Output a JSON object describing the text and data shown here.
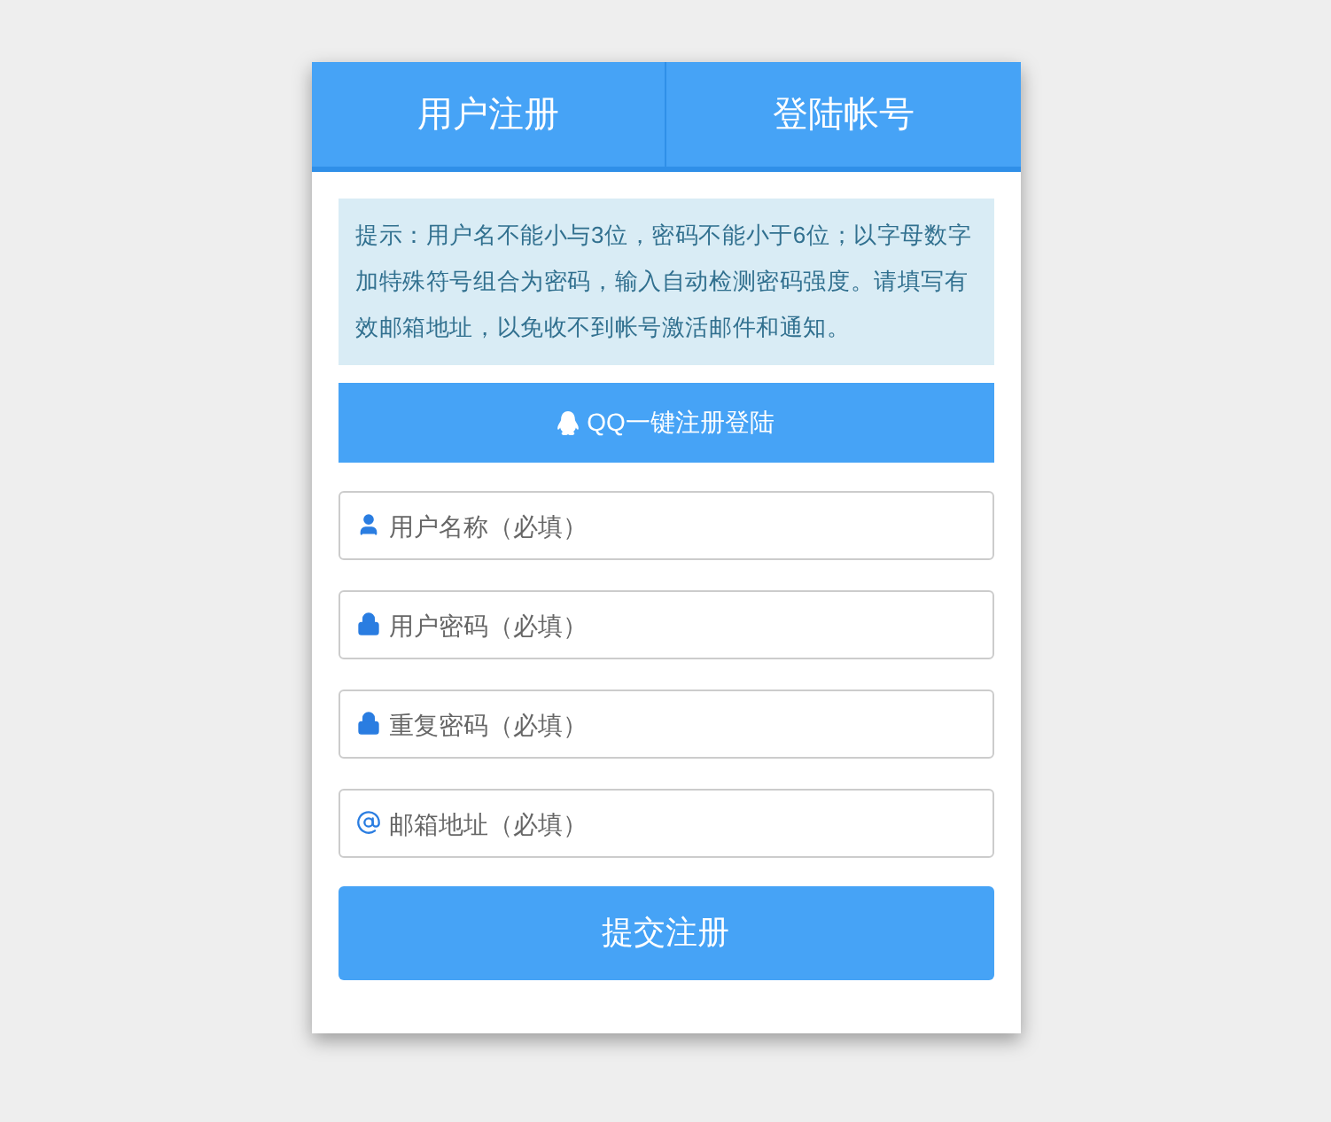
{
  "tabs": [
    {
      "label": "用户注册"
    },
    {
      "label": "登陆帐号"
    }
  ],
  "notice": "提示：用户名不能小与3位，密码不能小于6位；以字母数字加特殊符号组合为密码，输入自动检测密码强度。请填写有效邮箱地址，以免收不到帐号激活邮件和通知。",
  "qq_button": "QQ一键注册登陆",
  "fields": [
    {
      "kind": "user",
      "placeholder": "用户名称（必填）"
    },
    {
      "kind": "lock",
      "placeholder": "用户密码（必填）"
    },
    {
      "kind": "lock",
      "placeholder": "重复密码（必填）"
    },
    {
      "kind": "email",
      "placeholder": "邮箱地址（必填）"
    }
  ],
  "submit_button": "提交注册"
}
